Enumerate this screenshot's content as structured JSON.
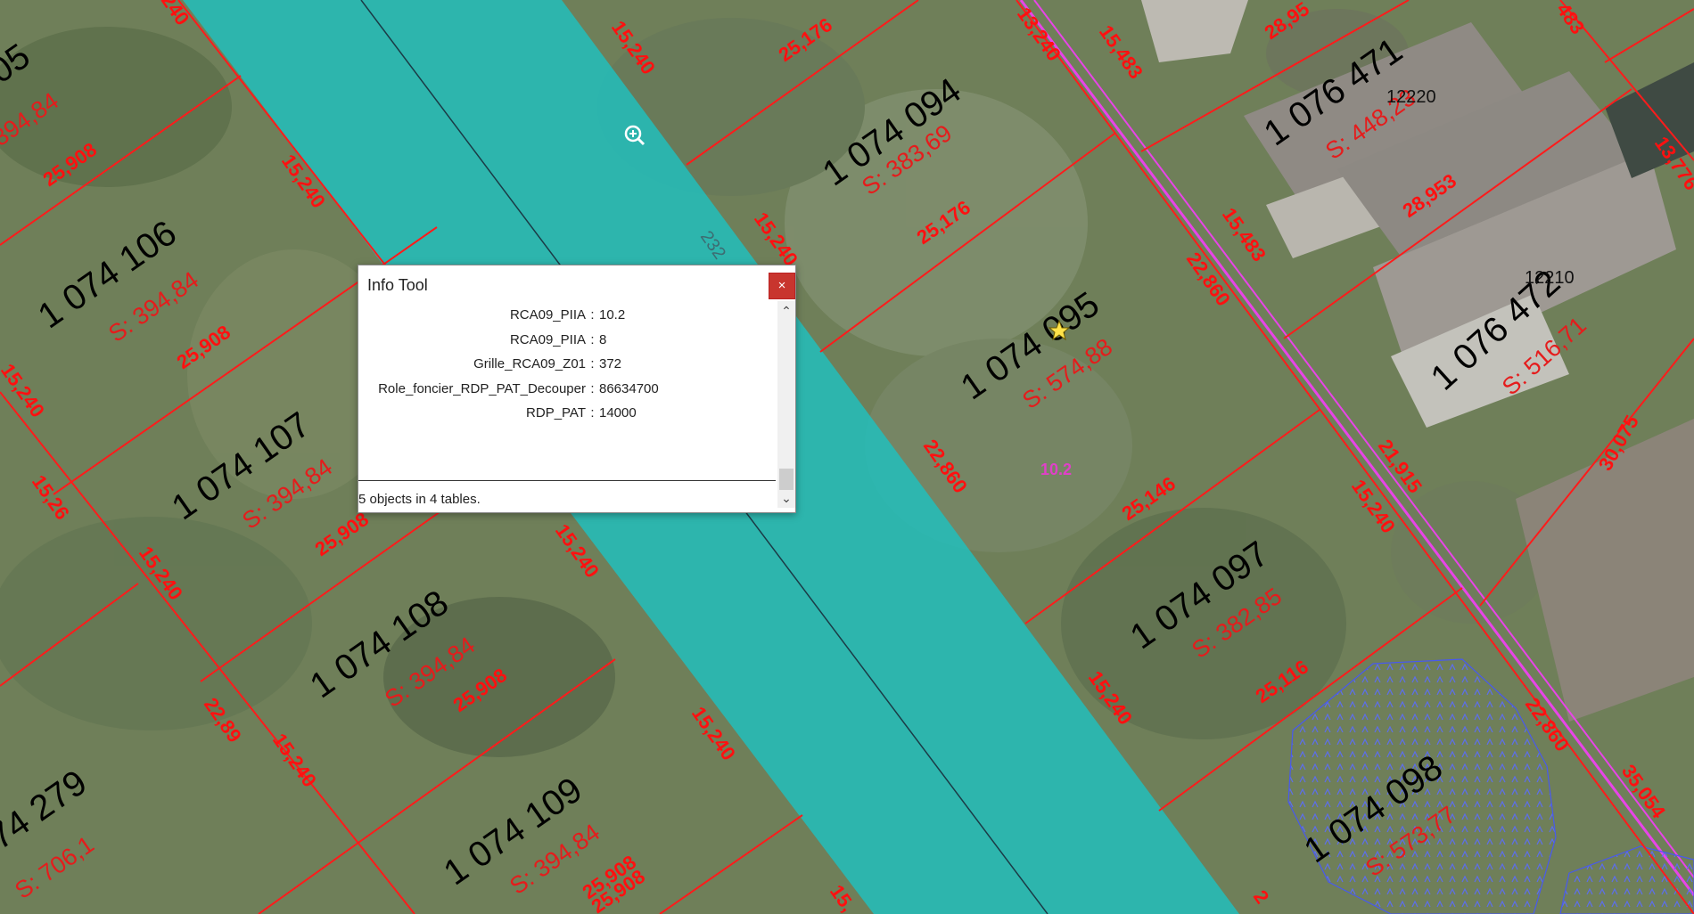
{
  "info_tool": {
    "title": "Info Tool",
    "close_icon": "×",
    "rows": [
      {
        "key": "RCA09_PIIA",
        "sep": ":",
        "value": "10.2"
      },
      {
        "key": "RCA09_PIIA",
        "sep": ":",
        "value": "8"
      },
      {
        "key": "Grille_RCA09_Z01",
        "sep": ":",
        "value": "372"
      },
      {
        "key": "Role_foncier_RDP_PAT_Decouper",
        "sep": ":",
        "value": "86634700"
      },
      {
        "key": "RDP_PAT",
        "sep": ":",
        "value": "14000"
      }
    ],
    "status": "5 objects in 4 tables.",
    "scroll_up_icon": "⌃",
    "scroll_down_icon": "⌄"
  },
  "map": {
    "lots": [
      {
        "id": "1 074 094",
        "area": "S: 383,69"
      },
      {
        "id": "1 074 095",
        "area": "S: 574,88"
      },
      {
        "id": "1 074 097",
        "area": "S: 382,85"
      },
      {
        "id": "1 074 098",
        "area": "S: 573,77"
      },
      {
        "id": "1 074 106",
        "area": "S: 394,84"
      },
      {
        "id": "1 074 107",
        "area": "S: 394,84"
      },
      {
        "id": "1 074 108",
        "area": "S: 394,84"
      },
      {
        "id": "1 074 109",
        "area": "S: 394,84"
      },
      {
        "id": "1 076 471",
        "area": "S: 448,23"
      },
      {
        "id": "1 076 472",
        "area": "S: 516,71"
      },
      {
        "id": "74 279",
        "area": "S: 706,1"
      },
      {
        "id": "05",
        "area": "394,84"
      }
    ],
    "dimensions": [
      "15,240",
      "25,176",
      "15,240",
      "25,908",
      "15,240",
      "25,908",
      "15,240",
      "25,908",
      "15,26",
      "15,240",
      "25,908",
      "22,89",
      "15,240",
      "25,908",
      "15,240",
      "15,240",
      "22,860",
      "25,146",
      "15,240",
      "25,116",
      "13,240",
      "15,483",
      "15,483",
      "22,860",
      "21,915",
      "15,240",
      "28,953",
      "28,95",
      "30,075",
      "22,860",
      "35,054",
      "13,776",
      "483",
      "240",
      "25,908",
      "15,240",
      "25,176",
      "15,",
      "2"
    ],
    "civic_numbers": [
      "12220",
      "12210"
    ],
    "corridor_label": "232",
    "pink_label": "10.2",
    "icons": {
      "zoom": "zoom-in-icon",
      "point": "star-point-icon"
    }
  }
}
